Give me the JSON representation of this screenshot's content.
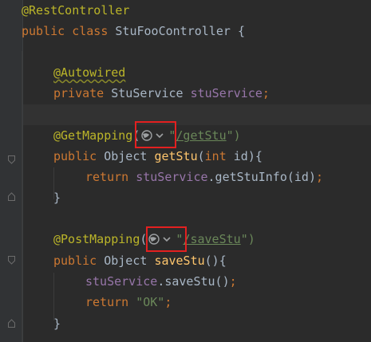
{
  "code": {
    "line1": {
      "annotation": "@RestController"
    },
    "line2": {
      "kw1": "public",
      "kw2": "class",
      "name": "StuFooController",
      "brace": "{"
    },
    "line4": {
      "annotation": "@Autowired"
    },
    "line5": {
      "kw": "private",
      "type": "StuService",
      "field": "stuService",
      "semi": ";"
    },
    "line7": {
      "annotation": "@GetMapping",
      "open": "(",
      "url": "/getStu",
      "close": "\")"
    },
    "line8": {
      "kw": "public",
      "type": "Object",
      "method": "getStu",
      "open": "(",
      "ptype": "int",
      "param": "id){"
    },
    "line9": {
      "kw": "return",
      "field": "stuService",
      "call": ".getStuInfo(id)",
      "semi": ";"
    },
    "line10": {
      "brace": "}"
    },
    "line12": {
      "annotation": "@PostMapping",
      "open": "(",
      "url": "/saveStu",
      "close": "\")"
    },
    "line13": {
      "kw": "public",
      "type": "Object",
      "method": "saveStu",
      "rest": "(){"
    },
    "line14": {
      "field": "stuService",
      "call": ".saveStu()",
      "semi": ";"
    },
    "line15": {
      "kw": "return",
      "str": "\"OK\"",
      "semi": ";"
    },
    "line16": {
      "brace": "}"
    }
  },
  "icons": {
    "mapping_icon": "globe-dropdown-icon",
    "fold_icon": "fold-marker-icon"
  },
  "colors": {
    "background": "#2b2b2b",
    "annotation": "#bbb529",
    "keyword": "#cc7832",
    "field": "#9876aa",
    "method": "#ffc66d",
    "string": "#6a8759",
    "highlight_box": "#e32020"
  }
}
